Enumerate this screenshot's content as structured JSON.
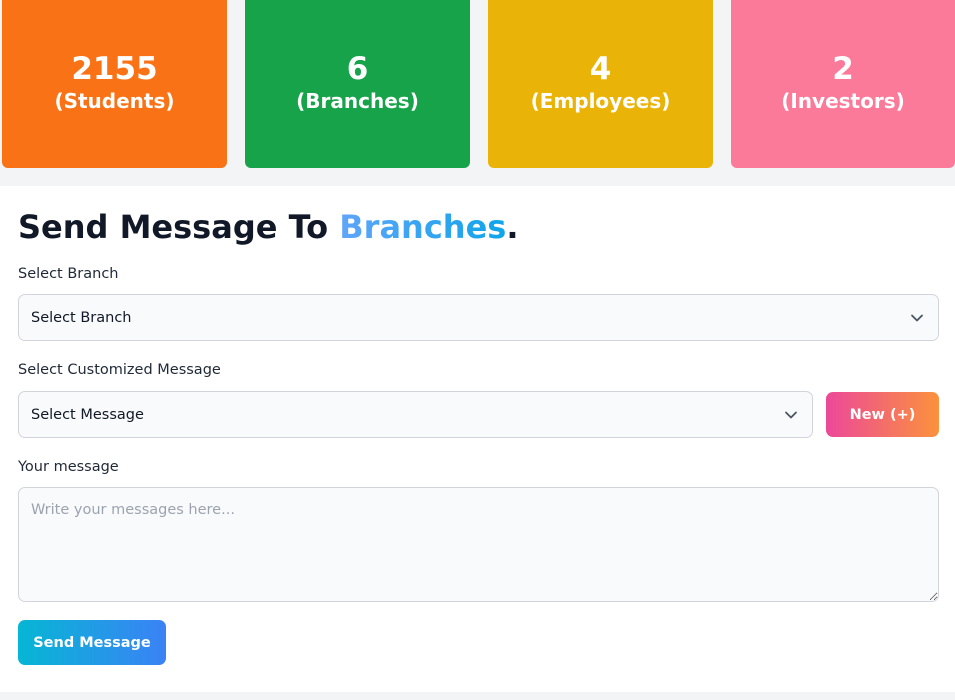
{
  "stats": [
    {
      "value": "2155",
      "label": "(Students)",
      "color": "#f97316"
    },
    {
      "value": "6",
      "label": "(Branches)",
      "color": "#16a34a"
    },
    {
      "value": "4",
      "label": "(Employees)",
      "color": "#eab308"
    },
    {
      "value": "2",
      "label": "(Investors)",
      "color": "#fb7a9a"
    }
  ],
  "form": {
    "title_prefix": "Send Message To ",
    "title_highlight": "Branches",
    "title_suffix": ".",
    "branch_label": "Select Branch",
    "branch_value": "Select Branch",
    "message_select_label": "Select Customized Message",
    "message_select_value": "Select Message",
    "new_button": "New (+)",
    "message_label": "Your message",
    "message_placeholder": "Write your messages here...",
    "send_button": "Send Message"
  },
  "icons": {
    "dropdown": "chevron-down-icon",
    "resize": "resize-handle"
  },
  "colors": {
    "title_highlight_start": "#60a5fa",
    "title_highlight_end": "#0ea5e9",
    "new_button_start": "#ec4899",
    "new_button_end": "#fb923c",
    "send_button_start": "#06b6d4",
    "send_button_end": "#3b82f6"
  }
}
